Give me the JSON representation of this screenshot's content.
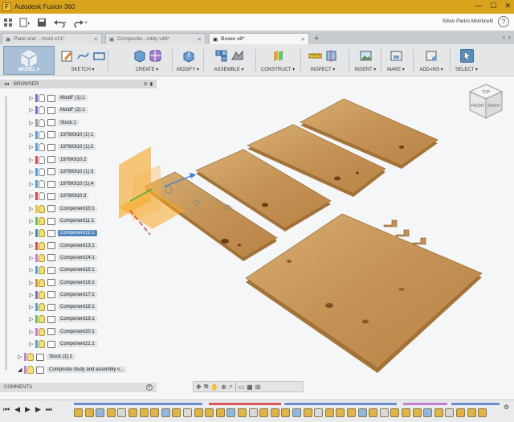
{
  "window": {
    "title": "Autodesk Fusion 360",
    "app_icon": "F",
    "controls": [
      "—",
      "☐",
      "✕"
    ]
  },
  "qat": {
    "user": "Silvio Pietro Monticelli",
    "help": "?"
  },
  "tabs": [
    {
      "label": "Plate and ...mold v21*",
      "active": false
    },
    {
      "label": "Composite...mbly v48*",
      "active": false
    },
    {
      "label": "Boxes v8*",
      "active": true
    }
  ],
  "toolbar": {
    "workspace": "MODEL ▾",
    "groups": [
      "SKETCH ▾",
      "CREATE ▾",
      "MODIFY ▾",
      "ASSEMBLE ▾",
      "CONSTRUCT ▾",
      "INSPECT ▾",
      "INSERT ▾",
      "MAKE ▾",
      "ADD-INS ▾",
      "SELECT ▾"
    ]
  },
  "browser": {
    "title": "BROWSER",
    "collapse": "◂◂",
    "items": [
      {
        "label": "MoldF (1):1",
        "stripe": "#7a6fc8",
        "bulb": false
      },
      {
        "label": "MoldF (2):1",
        "stripe": "#7a6fc8",
        "bulb": false
      },
      {
        "label": "Stock:1",
        "stripe": "#9b9b9b",
        "bulb": false
      },
      {
        "label": "1976K910 (1):1",
        "stripe": "#5aa0d8",
        "bulb": false
      },
      {
        "label": "1976K910 (1):2",
        "stripe": "#5aa0d8",
        "bulb": false
      },
      {
        "label": "1976K910:2",
        "stripe": "#d84b4b",
        "bulb": false
      },
      {
        "label": "1976K910 (1):3",
        "stripe": "#5aa0d8",
        "bulb": false
      },
      {
        "label": "1976K910 (1):4",
        "stripe": "#5aa0d8",
        "bulb": false
      },
      {
        "label": "1976K910:3",
        "stripe": "#d84b4b",
        "bulb": false
      },
      {
        "label": "Component10:1",
        "stripe": "#e6c23a",
        "bulb": true
      },
      {
        "label": "Component11:1",
        "stripe": "#6fbf5a",
        "bulb": true
      },
      {
        "label": "Component12:1",
        "stripe": "#4f86bd",
        "bulb": true,
        "selected": true
      },
      {
        "label": "Component13:1",
        "stripe": "#d84b4b",
        "bulb": true
      },
      {
        "label": "Component14:1",
        "stripe": "#c77ad6",
        "bulb": true
      },
      {
        "label": "Component15:1",
        "stripe": "#5aa0d8",
        "bulb": true
      },
      {
        "label": "Component16:1",
        "stripe": "#e08a3c",
        "bulb": true
      },
      {
        "label": "Component17:1",
        "stripe": "#7a6fc8",
        "bulb": true
      },
      {
        "label": "Component18:1",
        "stripe": "#5aa0d8",
        "bulb": true
      },
      {
        "label": "Component19:1",
        "stripe": "#6fbf5a",
        "bulb": true
      },
      {
        "label": "Component20:1",
        "stripe": "#c77ad6",
        "bulb": true
      },
      {
        "label": "Component21:1",
        "stripe": "#5aa0d8",
        "bulb": true
      }
    ],
    "footer_items": [
      {
        "label": "Stock (1):1",
        "stripe": "#c77ad6"
      },
      {
        "label": "Composite study and assembly v...",
        "stripe": "#c77ad6"
      }
    ]
  },
  "viewcube": {
    "top": "TOP",
    "front": "FRONT",
    "right": "RIGHT"
  },
  "comments": {
    "label": "COMMENTS",
    "add": "+"
  },
  "colors": {
    "titlebar": "#d9a21d",
    "wood": "#c9985a",
    "selection": "#4f86bd",
    "plane": "#f5a623"
  }
}
